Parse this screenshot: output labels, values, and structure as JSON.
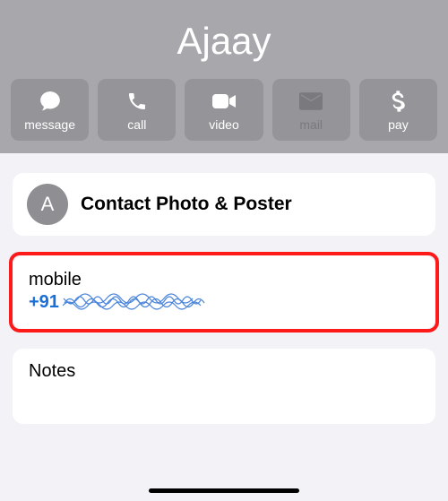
{
  "header": {
    "contact_name": "Ajaay"
  },
  "actions": {
    "message_label": "message",
    "call_label": "call",
    "video_label": "video",
    "mail_label": "mail",
    "pay_label": "pay"
  },
  "photo_poster": {
    "avatar_initial": "A",
    "title": "Contact Photo & Poster"
  },
  "phone": {
    "label": "mobile",
    "prefix": "+91"
  },
  "notes": {
    "title": "Notes"
  }
}
